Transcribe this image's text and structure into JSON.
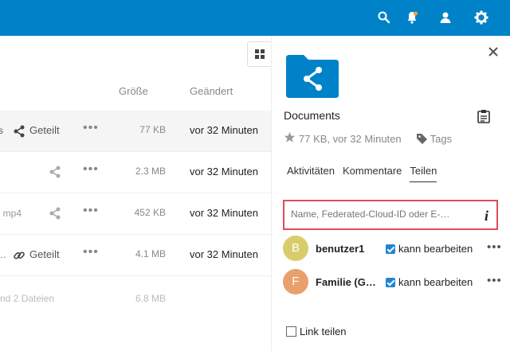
{
  "topbar": {
    "color": "#0082c9",
    "icons": [
      "search-icon",
      "notifications-icon",
      "contacts-icon",
      "settings-icon"
    ]
  },
  "files": {
    "headers": {
      "size": "Größe",
      "modified": "Geändert"
    },
    "rows": [
      {
        "name": "s",
        "shared_label": "Geteilt",
        "size": "77 KB",
        "modified": "vor 32 Minuten",
        "highlight": true
      },
      {
        "name": "",
        "shared_label": "",
        "size": "2.3 MB",
        "modified": "vor 32 Minuten"
      },
      {
        "name": "mp4",
        "shared_label": "",
        "size": "452 KB",
        "modified": "vor 32 Minuten"
      },
      {
        "name": "…",
        "shared_label": "Geteilt",
        "size": "4.1 MB",
        "modified": "vor 32 Minuten"
      }
    ],
    "summary": {
      "text": "nd 2 Dateien",
      "size": "6.8 MB"
    }
  },
  "sidebar": {
    "title": "Documents",
    "meta": "77 KB, vor 32 Minuten",
    "tags_label": "Tags",
    "tabs": [
      "Aktivitäten",
      "Kommentare",
      "Teilen"
    ],
    "active_tab": "Teilen",
    "share_input": {
      "placeholder": "Name, Federated-Cloud-ID oder E-…"
    },
    "shares": [
      {
        "initial": "B",
        "name": "benutzer1",
        "perm": "kann bearbeiten",
        "avatar_color": "#d9cc6c"
      },
      {
        "initial": "F",
        "name": "Familie (G…",
        "perm": "kann bearbeiten",
        "avatar_color": "#e8a06c"
      }
    ],
    "link_share": "Link teilen"
  }
}
